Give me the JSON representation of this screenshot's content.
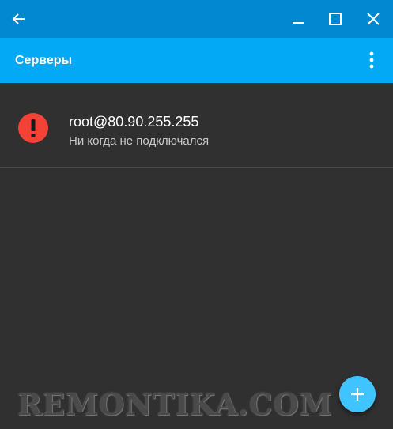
{
  "window": {
    "back_icon": "arrow-left-icon",
    "minimize_icon": "minimize-icon",
    "maximize_icon": "maximize-icon",
    "close_icon": "close-icon"
  },
  "appbar": {
    "title": "Серверы",
    "menu_icon": "more-vertical-icon"
  },
  "servers": [
    {
      "title": "root@80.90.255.255",
      "subtitle": "Ни когда не подключался",
      "status_icon": "alert-icon",
      "status_color": "#f44336"
    }
  ],
  "fab": {
    "icon": "plus-icon"
  },
  "watermark": "REMONTIKA.COM",
  "colors": {
    "titlebar": "#0288d1",
    "appbar": "#03a9f4",
    "background": "#303030",
    "fab": "#40c4ff",
    "error": "#f44336"
  }
}
